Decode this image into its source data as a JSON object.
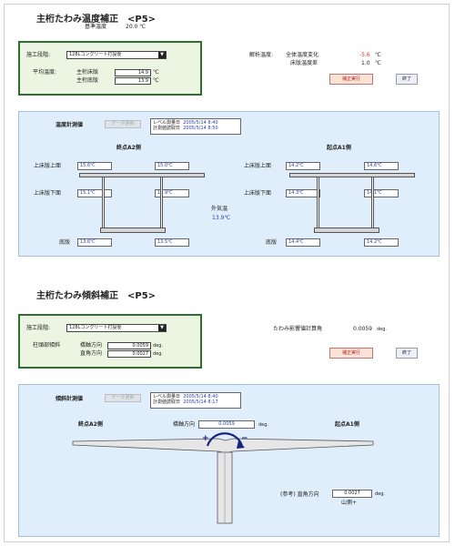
{
  "temp_section": {
    "title": "主桁たわみ温度補正　<P5>",
    "base_temp_label": "基準温度",
    "base_temp_value": "20.0 ℃",
    "stage_label": "施工段階:",
    "stage_value": "128Lコンクリート打設後",
    "avg_temp_label": "平均温度:",
    "upper_label": "主桁床版",
    "upper_value": "14.9",
    "lower_label": "主桁底版",
    "lower_value": "13.9",
    "unit_c": "℃",
    "analysis_label": "解析温度:",
    "total_change_label": "全体温度変化",
    "total_change_value": "-5.6",
    "slab_diff_label": "床版温度差",
    "slab_diff_value": "1.0",
    "apply_button": "補正実行",
    "close_button": "終了"
  },
  "temp_panel": {
    "title": "温度計測値",
    "data_button": "データ更新",
    "level_date_label": "レベル測量日",
    "level_date_value": "2005/5/14 8:40",
    "measure_date_label": "計測値読取日",
    "measure_date_value": "2005/5/14 8:50",
    "left_title": "終点A2側",
    "right_title": "起点A1側",
    "upper_top_label": "上床版上面",
    "upper_bottom_label": "上床版下面",
    "bottom_label": "底版",
    "outside_label": "外気温",
    "outside_value": "13.9℃",
    "left_upper_top": [
      "15.6℃",
      "15.0℃"
    ],
    "left_upper_bottom": [
      "15.1℃",
      "15.9℃"
    ],
    "left_bottom": [
      "13.6℃",
      "13.5℃"
    ],
    "right_upper_top": [
      "14.2℃",
      "14.6℃"
    ],
    "right_upper_bottom": [
      "14.3℃",
      "14.1℃"
    ],
    "right_bottom": [
      "14.4℃",
      "14.2℃"
    ]
  },
  "tilt_section": {
    "title": "主桁たわみ傾斜補正　<P5>",
    "stage_label": "施工段階:",
    "stage_value": "128Lコンクリート打設後",
    "col_tilt_label": "柱頭部傾斜",
    "axis_dir_label": "橋軸方向",
    "axis_dir_value": "0.0059",
    "perp_dir_label": "直角方向",
    "perp_dir_value": "0.0027",
    "unit_deg": "deg.",
    "angle_label": "たわみ影響値計算角",
    "angle_value": "0.0059",
    "angle_unit": "deg.",
    "apply_button": "補正実行",
    "close_button": "終了"
  },
  "tilt_panel": {
    "title": "傾斜計測値",
    "data_button": "データ更新",
    "level_date_label": "レベル測量日",
    "level_date_value": "2005/5/14 8:40",
    "measure_date_label": "計測値読取日",
    "measure_date_value": "2005/5/14 8:17",
    "left_title": "終点A2側",
    "right_title": "起点A1側",
    "axis_dir_label": "橋軸方向",
    "axis_dir_value": "0.0059",
    "deg": "deg.",
    "plus_sign": "+",
    "minus_sign": "−",
    "ref_label": "(参考) 直角方向",
    "ref_value": "0.0027",
    "ref_note": "山側+"
  },
  "colors": {
    "green_border": "#2f6e2f",
    "green_fill": "#ecf5e2",
    "panel_fill": "#dfeefa",
    "accent_red": "#d32f2f",
    "value_blue": "#2b3fa8"
  }
}
